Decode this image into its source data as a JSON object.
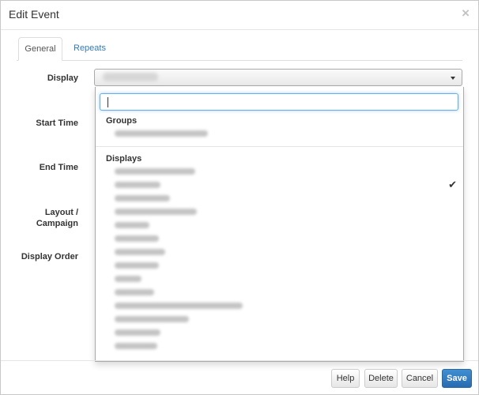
{
  "modal": {
    "title": "Edit Event",
    "close": "×"
  },
  "tabs": [
    {
      "label": "General"
    },
    {
      "label": "Repeats"
    }
  ],
  "fields": {
    "display": "Display",
    "start_time": "Start Time",
    "end_time": "End Time",
    "layout_line1": "Layout /",
    "layout_line2": "Campaign",
    "display_order": "Display Order"
  },
  "dropdown": {
    "search_value": "",
    "groups_heading": "Groups",
    "displays_heading": "Displays",
    "selected_check": "✔"
  },
  "buttons": {
    "help": "Help",
    "delete": "Delete",
    "cancel": "Cancel",
    "save": "Save"
  }
}
